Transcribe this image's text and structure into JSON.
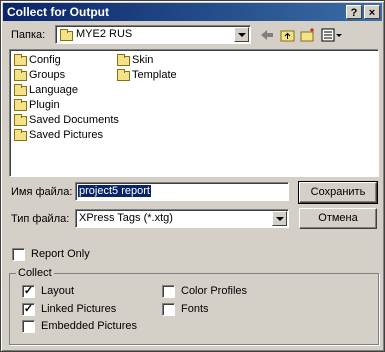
{
  "window": {
    "title": "Collect for Output",
    "help_label": "?",
    "close_label": "×"
  },
  "location": {
    "label": "Папка:",
    "value": "MYE2 RUS",
    "icons": [
      "back-arrow-icon",
      "up-folder-icon",
      "new-folder-icon",
      "view-menu-icon"
    ]
  },
  "folders": [
    "Config",
    "Groups",
    "Language",
    "Plugin",
    "Saved Documents",
    "Saved Pictures",
    "Skin",
    "Template"
  ],
  "filename": {
    "label": "Имя файла:",
    "value": "project5 report"
  },
  "filetype": {
    "label": "Тип файла:",
    "value": "XPress Tags (*.xtg)"
  },
  "buttons": {
    "save": "Сохранить",
    "cancel": "Отмена"
  },
  "report_only": {
    "label": "Report Only",
    "checked": false
  },
  "collect": {
    "title": "Collect",
    "options": [
      {
        "label": "Layout",
        "checked": true
      },
      {
        "label": "Linked Pictures",
        "checked": true
      },
      {
        "label": "Embedded Pictures",
        "checked": false
      },
      {
        "label": "Color Profiles",
        "checked": false
      },
      {
        "label": "Fonts",
        "checked": false
      }
    ]
  }
}
